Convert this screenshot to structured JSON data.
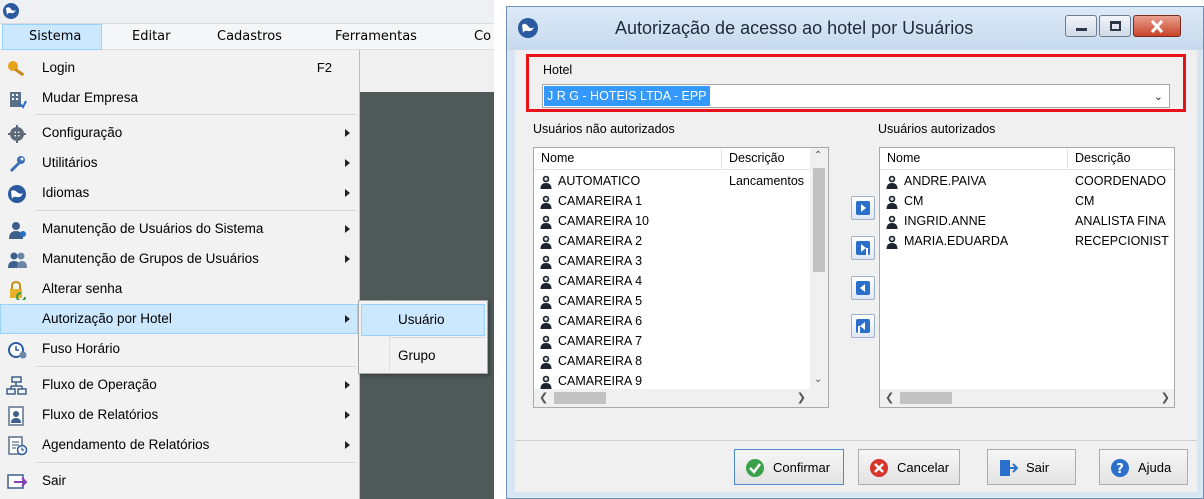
{
  "left_window": {
    "menubar": [
      "Sistema",
      "Editar",
      "Cadastros",
      "Ferramentas",
      "Co"
    ],
    "menu_items": [
      {
        "label": "Login",
        "shortcut": "F2",
        "icon": "key-icon",
        "submenu": false
      },
      {
        "label": "Mudar Empresa",
        "icon": "building-icon",
        "submenu": false
      },
      {
        "label": "Configuração",
        "icon": "gear-icon",
        "submenu": true
      },
      {
        "label": "Utilitários",
        "icon": "wrench-icon",
        "submenu": true
      },
      {
        "label": "Idiomas",
        "icon": "globe-icon",
        "submenu": true
      },
      {
        "label": "Manutenção de Usuários do Sistema",
        "icon": "user-icon",
        "submenu": true
      },
      {
        "label": "Manutenção de Grupos de Usuários",
        "icon": "users-icon",
        "submenu": true
      },
      {
        "label": "Alterar senha",
        "icon": "lock-icon",
        "submenu": false
      },
      {
        "label": "Autorização por Hotel",
        "icon": "",
        "submenu": true,
        "highlighted": true
      },
      {
        "label": "Fuso Horário",
        "icon": "clock-icon",
        "submenu": false
      },
      {
        "label": "Fluxo de Operação",
        "icon": "flow-icon",
        "submenu": true
      },
      {
        "label": "Fluxo de Relatórios",
        "icon": "report-icon",
        "submenu": true
      },
      {
        "label": "Agendamento de Relatórios",
        "icon": "schedule-icon",
        "submenu": true
      },
      {
        "label": "Sair",
        "icon": "exit-icon",
        "submenu": false
      }
    ],
    "submenu": [
      "Usuário",
      "Grupo"
    ]
  },
  "dialog": {
    "title": "Autorização de acesso ao hotel por Usuários",
    "hotel_label": "Hotel",
    "hotel_value": "J R G - HOTEIS LTDA - EPP",
    "left_list": {
      "label": "Usuários não autorizados",
      "columns": [
        "Nome",
        "Descrição"
      ],
      "rows": [
        {
          "nome": "AUTOMATICO",
          "descricao": "Lancamentos"
        },
        {
          "nome": "CAMAREIRA 1",
          "descricao": ""
        },
        {
          "nome": "CAMAREIRA 10",
          "descricao": ""
        },
        {
          "nome": "CAMAREIRA 2",
          "descricao": ""
        },
        {
          "nome": "CAMAREIRA 3",
          "descricao": ""
        },
        {
          "nome": "CAMAREIRA 4",
          "descricao": ""
        },
        {
          "nome": "CAMAREIRA 5",
          "descricao": ""
        },
        {
          "nome": "CAMAREIRA 6",
          "descricao": ""
        },
        {
          "nome": "CAMAREIRA 7",
          "descricao": ""
        },
        {
          "nome": "CAMAREIRA 8",
          "descricao": ""
        },
        {
          "nome": "CAMAREIRA 9",
          "descricao": ""
        }
      ]
    },
    "right_list": {
      "label": "Usuários autorizados",
      "columns": [
        "Nome",
        "Descrição"
      ],
      "rows": [
        {
          "nome": "ANDRE.PAIVA",
          "descricao": "COORDENADO"
        },
        {
          "nome": "CM",
          "descricao": "CM"
        },
        {
          "nome": "INGRID.ANNE",
          "descricao": "ANALISTA FINA"
        },
        {
          "nome": "MARIA.EDUARDA",
          "descricao": "RECEPCIONIST"
        }
      ]
    },
    "buttons": {
      "confirm": "Confirmar",
      "cancel": "Cancelar",
      "exit": "Sair",
      "help": "Ajuda"
    }
  },
  "colors": {
    "highlight_bg": "#cce8ff",
    "hotel_frame": "#e8131a",
    "selection": "#3399ff",
    "dark_area": "#4e5958"
  }
}
